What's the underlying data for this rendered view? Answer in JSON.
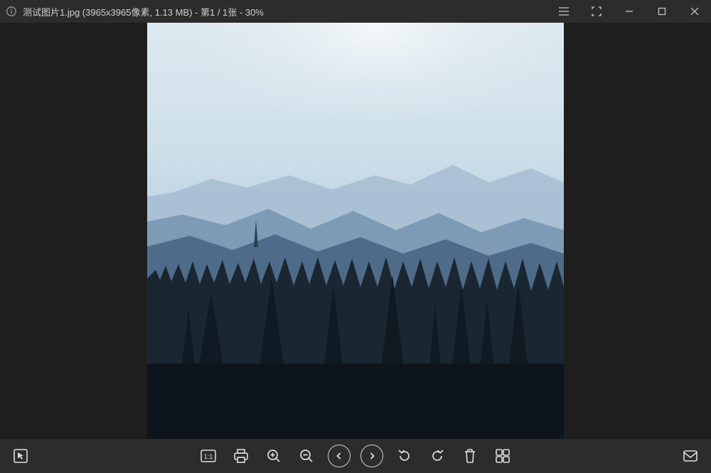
{
  "title": {
    "filename": "测试图片1.jpg",
    "dimensions": "3965x3965像素",
    "filesize": "1.13 MB",
    "position": "第1 / 1张",
    "zoom": "30%",
    "full": "测试图片1.jpg (3965x3965像素, 1.13 MB) - 第1 / 1张 - 30%"
  },
  "window_controls": {
    "menu": "menu",
    "fullscreen": "fullscreen",
    "minimize": "minimize",
    "maximize": "maximize",
    "close": "close"
  },
  "toolbar": {
    "select": "select",
    "actual_size": "1:1",
    "print": "print",
    "zoom_in": "zoom-in",
    "zoom_out": "zoom-out",
    "prev": "previous",
    "next": "next",
    "rotate_ccw": "rotate-ccw",
    "rotate_cw": "rotate-cw",
    "delete": "delete",
    "gallery": "gallery",
    "share": "share"
  }
}
